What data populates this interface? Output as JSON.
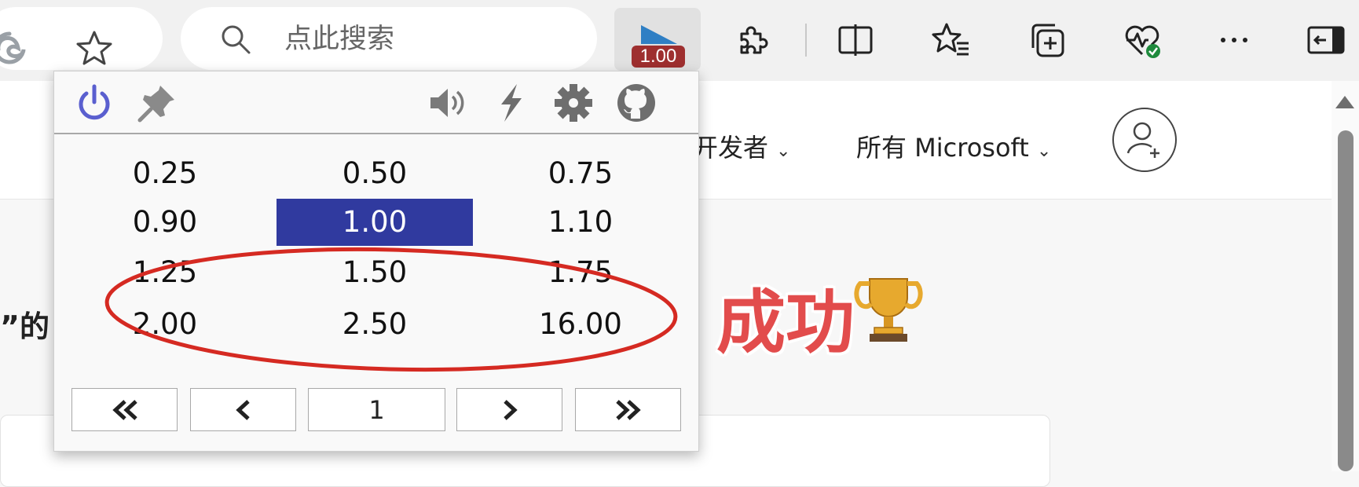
{
  "toolbar": {
    "search_placeholder": "点此搜索",
    "extension_badge": "1.00",
    "icons": [
      "edge-logo-icon",
      "favorite-star-icon",
      "search-icon",
      "video-speed-icon",
      "extensions-icon",
      "split-screen-icon",
      "favorites-icon",
      "collections-icon",
      "browser-essentials-icon",
      "more-icon",
      "sidebar-toggle-icon"
    ]
  },
  "page": {
    "nav": [
      {
        "label": "开发者"
      },
      {
        "label": "所有 Microsoft"
      }
    ],
    "left_text": "”的"
  },
  "popup": {
    "icons": [
      "power-icon",
      "pin-icon",
      "speaker-icon",
      "lightning-icon",
      "gear-icon",
      "github-icon"
    ],
    "speeds": [
      [
        "0.25",
        "0.50",
        "0.75"
      ],
      [
        "0.90",
        "1.00",
        "1.10"
      ],
      [
        "1.25",
        "1.50",
        "1.75"
      ],
      [
        "2.00",
        "2.50",
        "16.00"
      ]
    ],
    "active_speed": "1.00",
    "pager": {
      "page": "1"
    }
  },
  "annotation": {
    "text": "成功",
    "color": "#e24c4c"
  },
  "colors": {
    "active_cell": "#303a9f",
    "badge": "#9e2f2f",
    "power_icon": "#5a5fcf",
    "ellipse": "#d52a22"
  }
}
